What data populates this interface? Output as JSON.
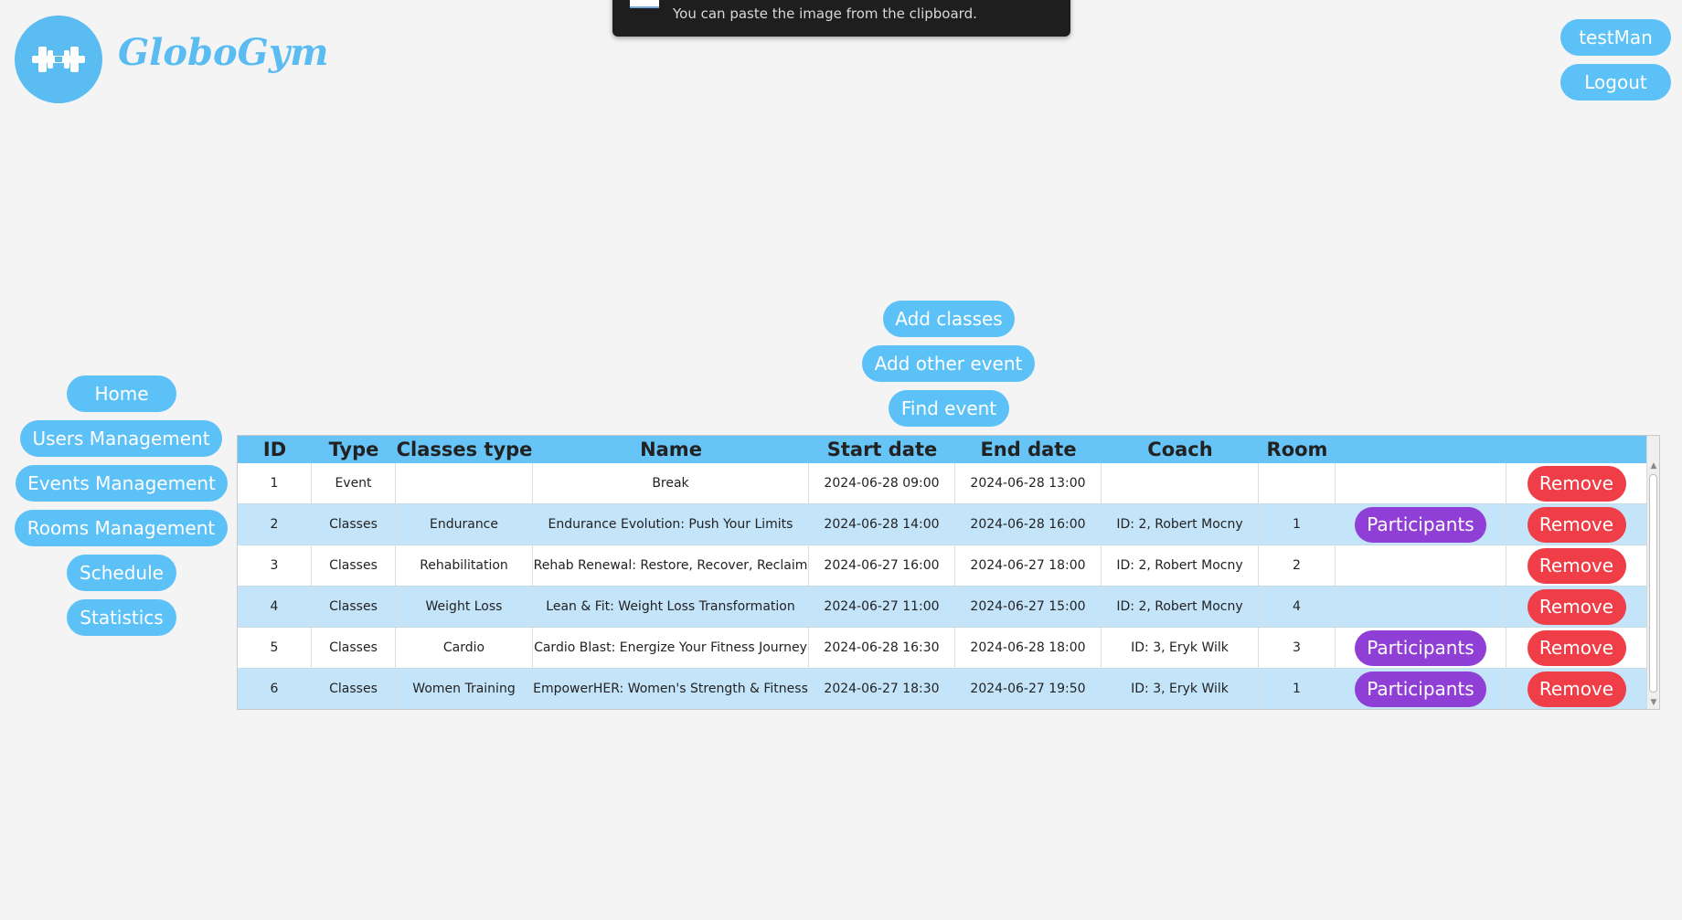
{
  "toast": {
    "message": "You can paste the image from the clipboard."
  },
  "brand": {
    "name": "GloboGym",
    "logo_icon": "dumbbell-icon",
    "color": "#5bbcf2"
  },
  "user": {
    "username": "testMan",
    "logout_label": "Logout"
  },
  "sidebar": {
    "items": [
      {
        "label": "Home"
      },
      {
        "label": "Users Management"
      },
      {
        "label": "Events Management"
      },
      {
        "label": "Rooms Management"
      },
      {
        "label": "Schedule"
      },
      {
        "label": "Statistics"
      }
    ]
  },
  "actions": {
    "add_classes": "Add classes",
    "add_other_event": "Add other event",
    "find_event": "Find event"
  },
  "table": {
    "columns": [
      "ID",
      "Type",
      "Classes type",
      "Name",
      "Start date",
      "End date",
      "Coach",
      "Room",
      "",
      ""
    ],
    "participants_label": "Participants",
    "remove_label": "Remove",
    "rows": [
      {
        "id": "1",
        "type": "Event",
        "classes_type": "",
        "name": "Break",
        "start": "2024-06-28 09:00",
        "end": "2024-06-28 13:00",
        "coach": "",
        "room": "",
        "has_participants": false
      },
      {
        "id": "2",
        "type": "Classes",
        "classes_type": "Endurance",
        "name": "Endurance Evolution: Push Your Limits",
        "start": "2024-06-28 14:00",
        "end": "2024-06-28 16:00",
        "coach": "ID: 2, Robert Mocny",
        "room": "1",
        "has_participants": true
      },
      {
        "id": "3",
        "type": "Classes",
        "classes_type": "Rehabilitation",
        "name": "Rehab Renewal: Restore, Recover, Reclaim",
        "start": "2024-06-27 16:00",
        "end": "2024-06-27 18:00",
        "coach": "ID: 2, Robert Mocny",
        "room": "2",
        "has_participants": false
      },
      {
        "id": "4",
        "type": "Classes",
        "classes_type": "Weight Loss",
        "name": "Lean & Fit: Weight Loss Transformation",
        "start": "2024-06-27 11:00",
        "end": "2024-06-27 15:00",
        "coach": "ID: 2, Robert Mocny",
        "room": "4",
        "has_participants": false
      },
      {
        "id": "5",
        "type": "Classes",
        "classes_type": "Cardio",
        "name": "Cardio Blast: Energize Your Fitness Journey",
        "start": "2024-06-28 16:30",
        "end": "2024-06-28 18:00",
        "coach": "ID: 3, Eryk Wilk",
        "room": "3",
        "has_participants": true
      },
      {
        "id": "6",
        "type": "Classes",
        "classes_type": "Women Training",
        "name": "EmpowerHER: Women's Strength & Fitness",
        "start": "2024-06-27 18:30",
        "end": "2024-06-27 19:50",
        "coach": "ID: 3, Eryk Wilk",
        "room": "1",
        "has_participants": true
      }
    ]
  },
  "colors": {
    "accent": "#5cc1f7",
    "header_bg": "#66c4f6",
    "row_alt": "#c4e4fa",
    "participants": "#8f3fd6",
    "remove": "#ef3e47"
  }
}
